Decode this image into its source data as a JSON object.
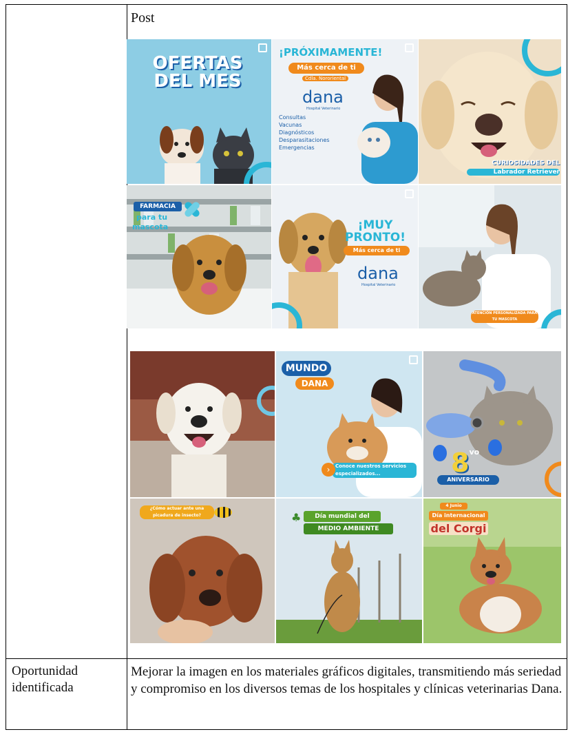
{
  "table": {
    "post_label": "Post",
    "opportunity_label": "Oportunidad identificada",
    "opportunity_text": "Mejorar la imagen en los materiales gráficos digitales, transmitiendo más seriedad y compromiso en los diversos temas de los hospitales y clínicas veterinarias Dana."
  },
  "posts": {
    "ofertas": {
      "title": "OFERTAS DEL MES"
    },
    "proximamente": {
      "title": "¡PRÓXIMAMENTE!",
      "subtitle": "Más cerca de ti",
      "location": "Cdla. Nororiental",
      "brand": "dana",
      "brand_sub": "Hospital Veterinario",
      "services": [
        "Consultas",
        "Vacunas",
        "Diagnósticos",
        "Desparasitaciones",
        "Emergencias"
      ]
    },
    "curiosidades": {
      "line1": "CURIOSIDADES DEL",
      "line2": "Labrador Retriever"
    },
    "farmacia": {
      "line1": "FARMACIA",
      "line2": "para tu",
      "line3": "mascota"
    },
    "muy_pronto": {
      "line1": "¡MUY",
      "line2": "PRONTO!",
      "subtitle": "Más cerca de ti",
      "brand": "dana",
      "brand_sub": "Hospital Veterinario"
    },
    "atencion": {
      "caption": "ATENCIÓN PERSONALIZADA PARA TU MASCOTA"
    },
    "mundo": {
      "line1": "MUNDO",
      "line2": "DANA",
      "caption": "Conoce nuestros servicios especializados..."
    },
    "aniversario": {
      "number": "8",
      "suffix": "vo",
      "label": "ANIVERSARIO"
    },
    "abejas": {
      "caption": "¿Cómo actuar ante una picadura de insecto?"
    },
    "ambiente": {
      "line1": "Día mundial del",
      "line2": "MEDIO AMBIENTE"
    },
    "corgi": {
      "tag": "4 Junio",
      "line1": "Día internacional",
      "line2": "del Corgi"
    }
  },
  "colors": {
    "accent": "#2ab6d6",
    "orange": "#f08a1c",
    "brand_blue": "#1b5fa8"
  }
}
